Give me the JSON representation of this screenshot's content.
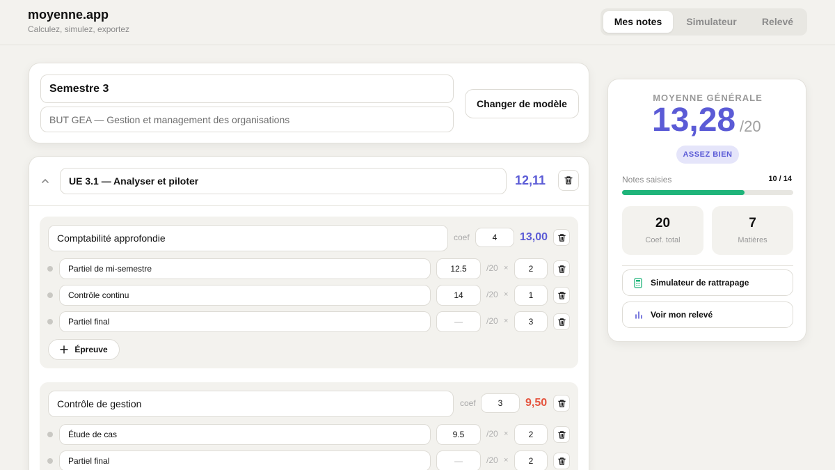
{
  "app": {
    "name": "moyenne.app",
    "tagline": "Calculez, simulez, exportez"
  },
  "nav": {
    "tabs": [
      {
        "label": "Mes notes",
        "active": true
      },
      {
        "label": "Simulateur"
      },
      {
        "label": "Relevé"
      }
    ]
  },
  "semester": {
    "title": "Semestre 3",
    "program": "BUT GEA — Gestion et management des organisations",
    "change_template_label": "Changer de modèle"
  },
  "ue": {
    "title": "UE 3.1 — Analyser et piloter",
    "average": "12,11",
    "subjects": [
      {
        "name": "Comptabilité approfondie",
        "coef_label": "coef",
        "coef": "4",
        "average": "13,00",
        "average_color": "#5b5bd6",
        "exams": [
          {
            "name": "Partiel de mi-semestre",
            "grade": "12.5",
            "over": "/20",
            "times": "×",
            "weight": "2"
          },
          {
            "name": "Contrôle continu",
            "grade": "14",
            "over": "/20",
            "times": "×",
            "weight": "1"
          },
          {
            "name": "Partiel final",
            "grade": "—",
            "over": "/20",
            "times": "×",
            "weight": "3"
          }
        ],
        "add_exam_label": "Épreuve"
      },
      {
        "name": "Contrôle de gestion",
        "coef_label": "coef",
        "coef": "3",
        "average": "9,50",
        "average_color": "#e5533d",
        "exams": [
          {
            "name": "Étude de cas",
            "grade": "9.5",
            "over": "/20",
            "times": "×",
            "weight": "2"
          },
          {
            "name": "Partiel final",
            "grade": "—",
            "over": "/20",
            "times": "×",
            "weight": "2"
          }
        ]
      }
    ]
  },
  "summary": {
    "label": "MOYENNE GÉNÉRALE",
    "value": "13,28",
    "over": "/20",
    "mention": "ASSEZ BIEN",
    "progress_label": "Notes saisies",
    "progress_count": "10",
    "progress_sep": " / ",
    "progress_total": "14",
    "progress_fraction": 0.714,
    "coef_total": "20",
    "coef_total_label": "Coef. total",
    "subjects_count": "7",
    "subjects_label": "Matières",
    "retake_label": "Simulateur de rattrapage",
    "transcript_label": "Voir mon relevé"
  },
  "colors": {
    "accent": "#5b5bd6",
    "danger": "#e5533d",
    "progress": "#1fb47a"
  },
  "icons": [
    "chevron-up-icon",
    "trash-icon",
    "plus-icon",
    "calculator-icon",
    "bar-chart-icon"
  ]
}
